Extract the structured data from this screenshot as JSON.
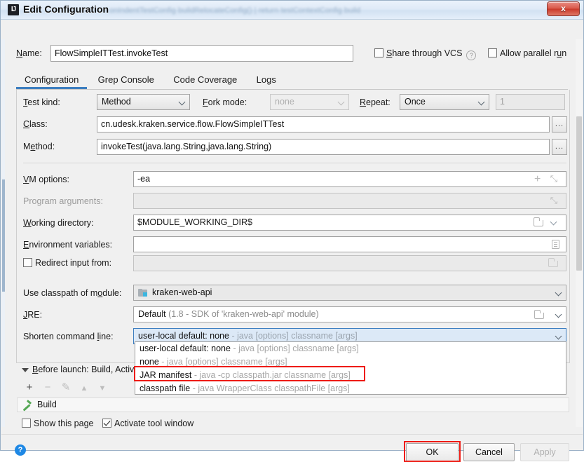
{
  "window": {
    "title": "Edit Configuration",
    "app_icon": "IJ",
    "ghost_text_behind": "onIndentTestConfig  buildRelocateConfig()  |  return  testContextConfig  build",
    "close_label": "x"
  },
  "name_row": {
    "label": "Name:",
    "value": "FlowSimpleITTest.invokeTest",
    "share_vcs_label": "Share through VCS",
    "share_vcs_checked": false,
    "help_glyph": "?",
    "allow_parallel_label": "Allow parallel run",
    "allow_parallel_checked": false
  },
  "tabs": [
    {
      "label": "Configuration",
      "active": true
    },
    {
      "label": "Grep Console",
      "active": false
    },
    {
      "label": "Code Coverage",
      "active": false
    },
    {
      "label": "Logs",
      "active": false
    }
  ],
  "form": {
    "test_kind": {
      "label": "Test kind:",
      "value": "Method"
    },
    "fork_mode": {
      "label": "Fork mode:",
      "value": "none",
      "disabled": true
    },
    "repeat": {
      "label": "Repeat:",
      "value": "Once"
    },
    "repeat_count": {
      "value": "1",
      "disabled": true
    },
    "class": {
      "label": "Class:",
      "value": "cn.udesk.kraken.service.flow.FlowSimpleITTest",
      "browse": "..."
    },
    "method": {
      "label": "Method:",
      "value": "invokeTest(java.lang.String,java.lang.String)",
      "browse": "..."
    },
    "vm_options": {
      "label": "VM options:",
      "value": "-ea"
    },
    "program_arguments": {
      "label": "Program arguments:",
      "value": "",
      "disabled": true
    },
    "working_directory": {
      "label": "Working directory:",
      "value": "$MODULE_WORKING_DIR$"
    },
    "environment_variables": {
      "label": "Environment variables:",
      "value": ""
    },
    "redirect_input": {
      "label": "Redirect input from:",
      "checked": false,
      "value": ""
    },
    "use_classpath_module": {
      "label": "Use classpath of module:",
      "value": "kraken-web-api"
    },
    "jre": {
      "label": "JRE:",
      "value": "Default",
      "value_hint": "(1.8 - SDK of 'kraken-web-api' module)"
    },
    "shorten_command_line": {
      "label": "Shorten command line:",
      "value_bold": "user-local default: none",
      "value_hint": "- java [options] classname [args]"
    }
  },
  "dropdown": {
    "items": [
      {
        "bold": "user-local default: none",
        "hint": "- java [options] classname [args]",
        "highlighted": false
      },
      {
        "bold": "none",
        "hint": "- java [options] classname [args]",
        "highlighted": false
      },
      {
        "bold": "JAR manifest",
        "hint": "- java -cp classpath.jar classname [args]",
        "highlighted": true
      },
      {
        "bold": "classpath file",
        "hint": "- java WrapperClass classpathFile [args]",
        "highlighted": false
      }
    ]
  },
  "before_launch": {
    "header": "Before launch: Build, Activa",
    "toolbar": [
      {
        "name": "add",
        "glyph": "+",
        "disabled": false
      },
      {
        "name": "remove",
        "glyph": "−",
        "disabled": true
      },
      {
        "name": "edit",
        "glyph": "✎",
        "disabled": true
      },
      {
        "name": "move-up",
        "glyph": "▲",
        "disabled": true
      },
      {
        "name": "move-down",
        "glyph": "▼",
        "disabled": true
      }
    ],
    "task": "Build",
    "show_this_page": {
      "label": "Show this page",
      "checked": false
    },
    "activate_tool_window": {
      "label": "Activate tool window",
      "checked": true
    }
  },
  "footer": {
    "help_glyph": "?",
    "ok": "OK",
    "cancel": "Cancel",
    "apply": "Apply",
    "apply_disabled": true
  },
  "colors": {
    "accent_blue": "#3d7ec0",
    "highlight_red": "#ee1b14",
    "selected_combo_bg": "#dce9f7",
    "selected_combo_border": "#3d7ec0",
    "module_icon_cyan": "#3bb6e0",
    "build_icon_green": "#55a855",
    "help_icon_blue": "#1e88e5",
    "close_button_red": "#c93a2b"
  }
}
